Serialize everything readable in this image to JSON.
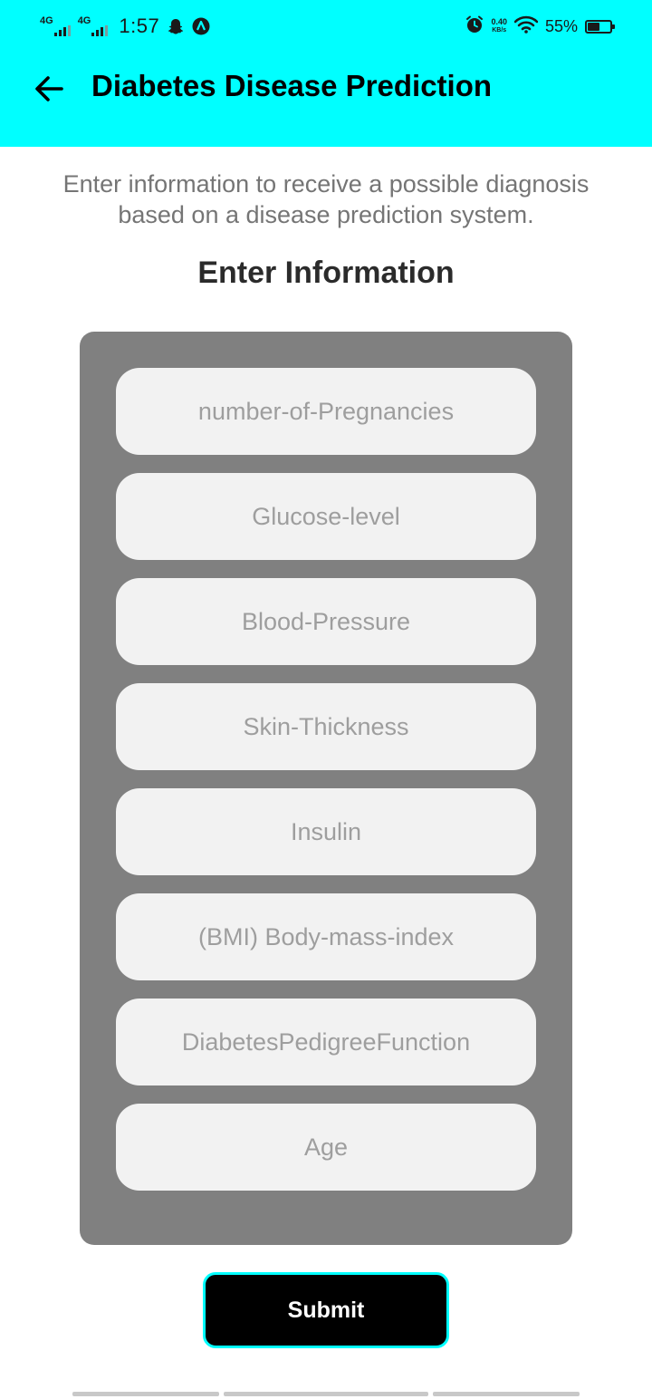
{
  "status_bar": {
    "network_1": "4G",
    "network_2": "4G",
    "time": "1:57",
    "speed_value": "0.40",
    "speed_unit": "KB/s",
    "battery_percent": "55%",
    "battery_level": 0.55,
    "icons": [
      "signal-icon",
      "snapchat-icon",
      "app-notification-icon",
      "alarm-icon",
      "wifi-icon",
      "battery-icon"
    ]
  },
  "header": {
    "title": "Diabetes Disease Prediction",
    "back_icon": "arrow-left-icon",
    "background_color": "#00ffff"
  },
  "intro": {
    "text": "Enter information to receive a possible diagnosis based on a disease prediction system."
  },
  "form": {
    "heading": "Enter Information",
    "fields": [
      {
        "placeholder": "number-of-Pregnancies",
        "value": ""
      },
      {
        "placeholder": "Glucose-level",
        "value": ""
      },
      {
        "placeholder": "Blood-Pressure",
        "value": ""
      },
      {
        "placeholder": "Skin-Thickness",
        "value": ""
      },
      {
        "placeholder": "Insulin",
        "value": ""
      },
      {
        "placeholder": "(BMI) Body-mass-index",
        "value": ""
      },
      {
        "placeholder": "DiabetesPedigreeFunction",
        "value": ""
      },
      {
        "placeholder": "Age",
        "value": ""
      }
    ],
    "submit_label": "Submit"
  },
  "colors": {
    "accent": "#00ffff",
    "card": "#808080",
    "field": "#f2f2f2",
    "button": "#000000"
  }
}
